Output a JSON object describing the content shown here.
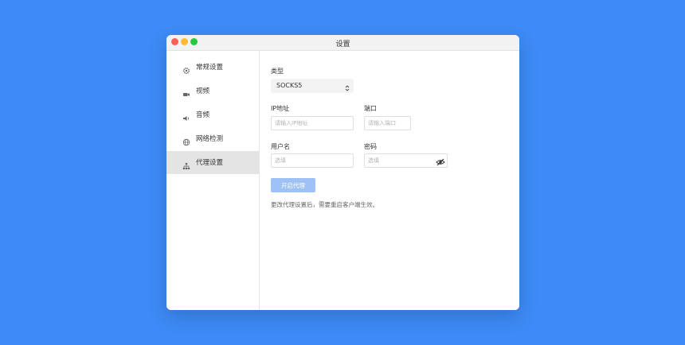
{
  "window": {
    "title": "设置"
  },
  "sidebar": {
    "items": [
      {
        "label": "常规设置",
        "icon": "gear-icon",
        "active": false
      },
      {
        "label": "视频",
        "icon": "video-icon",
        "active": false
      },
      {
        "label": "音频",
        "icon": "speaker-icon",
        "active": false
      },
      {
        "label": "网络检测",
        "icon": "globe-icon",
        "active": false
      },
      {
        "label": "代理设置",
        "icon": "network-tree-icon",
        "active": true
      }
    ]
  },
  "proxy": {
    "type_label": "类型",
    "type_value": "SOCKS5",
    "ip_label": "IP地址",
    "ip_placeholder": "请输入IP地址",
    "port_label": "端口",
    "port_placeholder": "请输入端口",
    "username_label": "用户名",
    "username_placeholder": "选填",
    "password_label": "密码",
    "password_placeholder": "选填",
    "enable_button": "开启代理",
    "note": "更改代理设置后，需要重启客户端生效。"
  },
  "colors": {
    "background": "#3d8bf7",
    "active_sidebar": "#e4e4e4",
    "button_disabled": "#9fc2f6"
  }
}
